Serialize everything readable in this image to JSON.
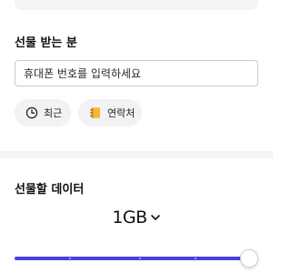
{
  "recipient": {
    "label": "선물 받는 분",
    "phone_placeholder": "휴대폰 번호를 입력하세요",
    "phone_value": "",
    "recent_button": {
      "label": "최근",
      "icon": "clock-icon"
    },
    "contacts_button": {
      "label": "연락처",
      "icon": "contact-book-icon"
    }
  },
  "gift_data": {
    "label": "선물할 데이터",
    "amount": "1GB",
    "amount_icon": "chevron-down-icon",
    "slider_fraction": 1.0
  },
  "colors": {
    "accent": "#4a3fe0",
    "contact_icon": "#f5b82e",
    "pill_bg": "#f2f2f4",
    "divider": "#f4f4f6"
  }
}
